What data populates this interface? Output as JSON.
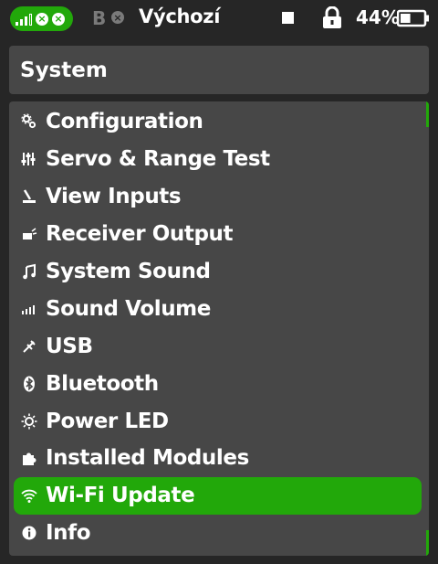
{
  "status_bar": {
    "link_icons": [
      "signal-bars-icon",
      "close-circle-icon",
      "close-circle-icon"
    ],
    "receiver_b_label": "B",
    "model_name": "Výchozí",
    "battery_percent": "44%",
    "battery_level": 0.44,
    "colors": {
      "accent": "#22a80a",
      "muted": "#7a7a7a"
    }
  },
  "header": {
    "title": "System"
  },
  "menu": {
    "items": [
      {
        "label": "Configuration",
        "icon": "gears-icon"
      },
      {
        "label": "Servo & Range Test",
        "icon": "sliders-icon"
      },
      {
        "label": "View Inputs",
        "icon": "joystick-icon"
      },
      {
        "label": "Receiver Output",
        "icon": "receiver-icon"
      },
      {
        "label": "System Sound",
        "icon": "music-note-icon"
      },
      {
        "label": "Sound Volume",
        "icon": "volume-bars-icon"
      },
      {
        "label": "USB",
        "icon": "usb-plug-icon"
      },
      {
        "label": "Bluetooth",
        "icon": "bluetooth-icon"
      },
      {
        "label": "Power LED",
        "icon": "led-sun-icon"
      },
      {
        "label": "Installed Modules",
        "icon": "puzzle-icon"
      },
      {
        "label": "Wi-Fi Update",
        "icon": "wifi-icon",
        "selected": true
      },
      {
        "label": "Info",
        "icon": "info-icon"
      }
    ]
  }
}
